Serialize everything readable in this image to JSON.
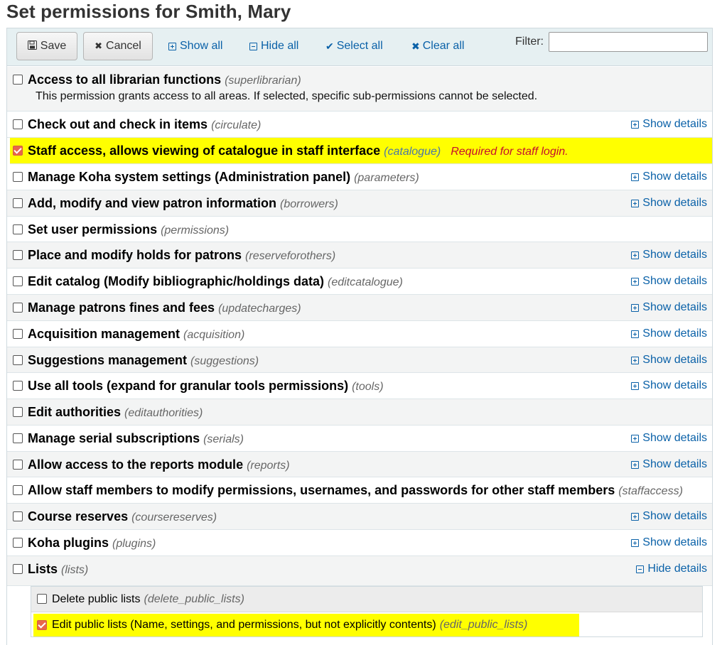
{
  "page_title": "Set permissions for Smith, Mary",
  "toolbar": {
    "save_label": "Save",
    "cancel_label": "Cancel",
    "show_all_label": "Show all",
    "hide_all_label": "Hide all",
    "select_all_label": "Select all",
    "clear_all_label": "Clear all",
    "filter_label": "Filter:",
    "filter_value": ""
  },
  "permissions": [
    {
      "label": "Access to all librarian functions",
      "code": "(superlibrarian)",
      "checked": false,
      "details": "",
      "description": "This permission grants access to all areas. If selected, specific sub-permissions cannot be selected."
    },
    {
      "label": "Check out and check in items",
      "code": "(circulate)",
      "checked": false,
      "details": "Show details"
    },
    {
      "label": "Staff access, allows viewing of catalogue in staff interface",
      "code": "(catalogue)",
      "checked": true,
      "details": "",
      "note": "Required for staff login."
    },
    {
      "label": "Manage Koha system settings (Administration panel)",
      "code": "(parameters)",
      "checked": false,
      "details": "Show details"
    },
    {
      "label": "Add, modify and view patron information",
      "code": "(borrowers)",
      "checked": false,
      "details": "Show details"
    },
    {
      "label": "Set user permissions",
      "code": "(permissions)",
      "checked": false,
      "details": ""
    },
    {
      "label": "Place and modify holds for patrons",
      "code": "(reserveforothers)",
      "checked": false,
      "details": "Show details"
    },
    {
      "label": "Edit catalog (Modify bibliographic/holdings data)",
      "code": "(editcatalogue)",
      "checked": false,
      "details": "Show details"
    },
    {
      "label": "Manage patrons fines and fees",
      "code": "(updatecharges)",
      "checked": false,
      "details": "Show details"
    },
    {
      "label": "Acquisition management",
      "code": "(acquisition)",
      "checked": false,
      "details": "Show details"
    },
    {
      "label": "Suggestions management",
      "code": "(suggestions)",
      "checked": false,
      "details": "Show details"
    },
    {
      "label": "Use all tools (expand for granular tools permissions)",
      "code": "(tools)",
      "checked": false,
      "details": "Show details"
    },
    {
      "label": "Edit authorities",
      "code": "(editauthorities)",
      "checked": false,
      "details": ""
    },
    {
      "label": "Manage serial subscriptions",
      "code": "(serials)",
      "checked": false,
      "details": "Show details"
    },
    {
      "label": "Allow access to the reports module",
      "code": "(reports)",
      "checked": false,
      "details": "Show details"
    },
    {
      "label": "Allow staff members to modify permissions, usernames, and passwords for other staff members",
      "code": "(staffaccess)",
      "checked": false,
      "details": ""
    },
    {
      "label": "Course reserves",
      "code": "(coursereserves)",
      "checked": false,
      "details": "Show details"
    },
    {
      "label": "Koha plugins",
      "code": "(plugins)",
      "checked": false,
      "details": "Show details"
    },
    {
      "label": "Lists",
      "code": "(lists)",
      "checked": false,
      "details": "Hide details"
    }
  ],
  "sub_permissions": [
    {
      "label": "Delete public lists",
      "code": "(delete_public_lists)",
      "checked": false
    },
    {
      "label": "Edit public lists (Name, settings, and permissions, but not explicitly contents)",
      "code": "(edit_public_lists)",
      "checked": true
    }
  ]
}
